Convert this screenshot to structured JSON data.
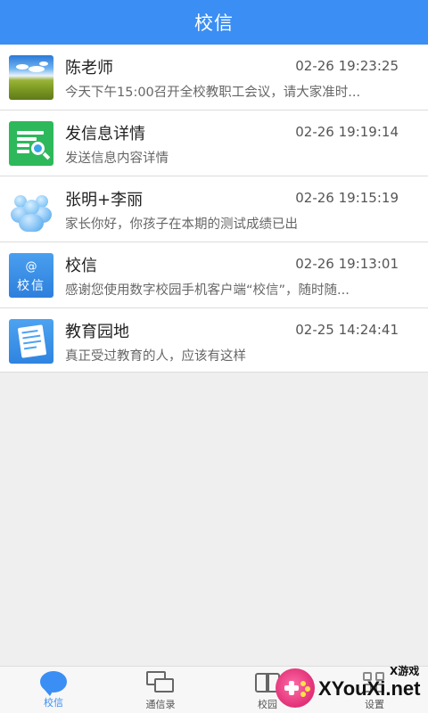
{
  "header": {
    "title": "校信"
  },
  "messages": [
    {
      "name": "陈老师",
      "time": "02-26 19:23:25",
      "preview": "今天下午15:00召开全校教职工会议，请大家准时...",
      "avatar": "landscape-photo"
    },
    {
      "name": "发信息详情",
      "time": "02-26 19:19:14",
      "preview": "发送信息内容详情",
      "avatar": "document-search-icon"
    },
    {
      "name": "张明+李丽",
      "time": "02-26 19:15:19",
      "preview": "家长你好，你孩子在本期的测试成绩已出",
      "avatar": "group-icon"
    },
    {
      "name": "校信",
      "time": "02-26 19:13:01",
      "preview": "感谢您使用数字校园手机客户端“校信”，随时随...",
      "avatar": "school-mail-icon",
      "avatar_label": "校信"
    },
    {
      "name": "教育园地",
      "time": "02-25 14:24:41",
      "preview": "真正受过教育的人，应该有这样",
      "avatar": "newspaper-icon"
    }
  ],
  "bottom_nav": [
    {
      "label": "校信",
      "icon": "chat-bubble-icon",
      "active": true
    },
    {
      "label": "通信录",
      "icon": "contacts-icon",
      "active": false
    },
    {
      "label": "校园",
      "icon": "book-icon",
      "active": false
    },
    {
      "label": "设置",
      "icon": "more-icon",
      "active": false
    }
  ],
  "watermark": {
    "site": "XYouXi.net",
    "tag": "X游戏"
  },
  "colors": {
    "accent": "#3b8ef3",
    "background": "#efefef"
  }
}
